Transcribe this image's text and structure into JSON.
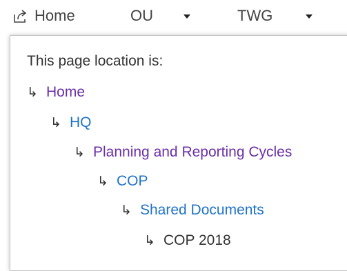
{
  "topnav": {
    "home_label": "Home",
    "ou_label": "OU",
    "twg_label": "TWG"
  },
  "flyout": {
    "title": "This page location is:",
    "crumbs": [
      {
        "label": "Home",
        "color": "#6b2fa6"
      },
      {
        "label": "HQ",
        "color": "#1f73c7"
      },
      {
        "label": "Planning and Reporting Cycles",
        "color": "#6b2fa6"
      },
      {
        "label": "COP",
        "color": "#1f73c7"
      },
      {
        "label": "Shared Documents",
        "color": "#1f73c7"
      },
      {
        "label": "COP 2018",
        "color": "#333333"
      }
    ],
    "arrow_glyph": "↳"
  }
}
